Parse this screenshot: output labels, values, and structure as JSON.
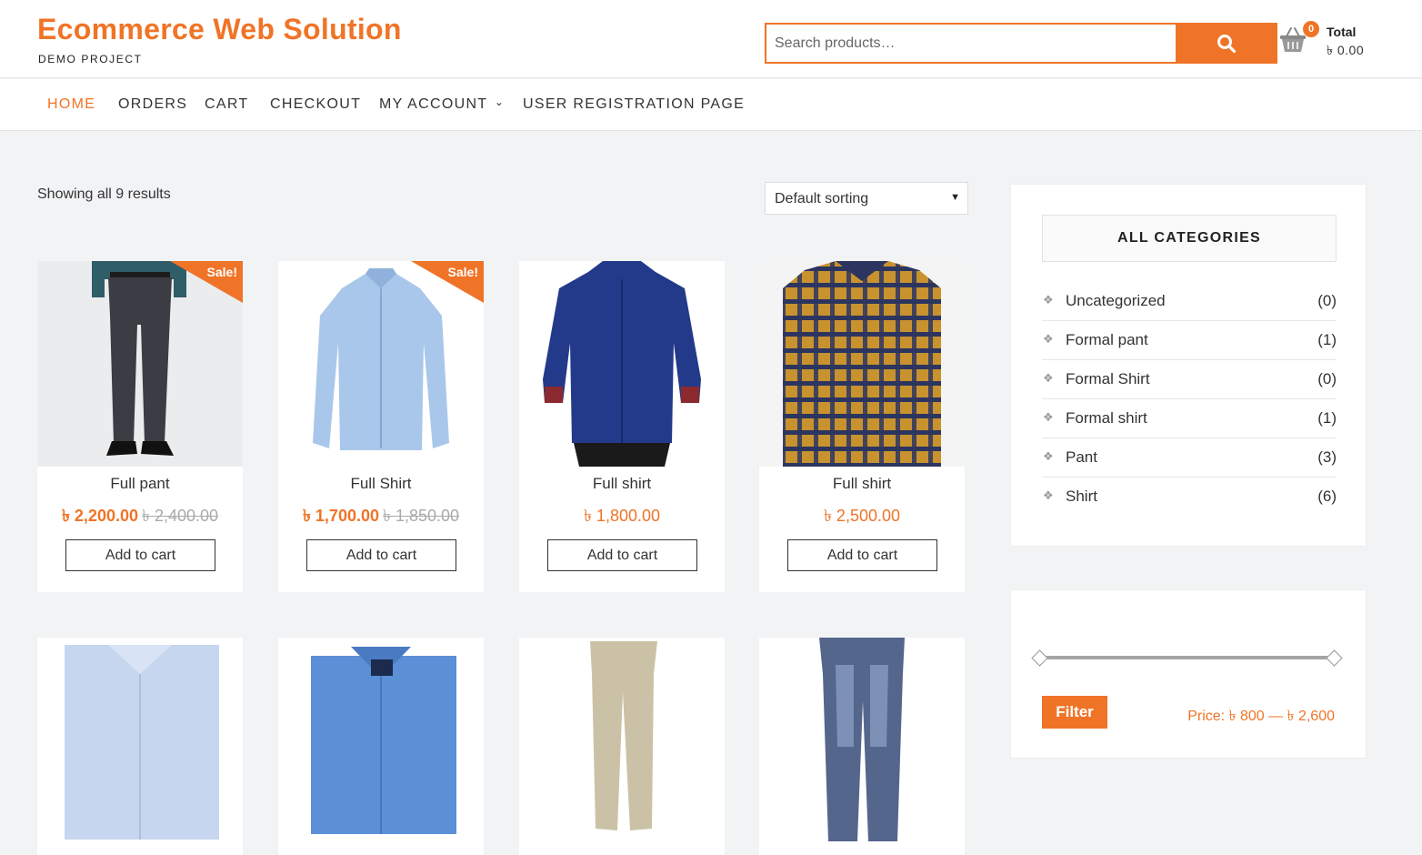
{
  "site": {
    "title": "Ecommerce Web Solution",
    "subtitle": "DEMO PROJECT"
  },
  "search": {
    "placeholder": "Search products…",
    "icon": "search-icon"
  },
  "cart": {
    "icon": "basket-icon",
    "count": "0",
    "total_label": "Total",
    "total_value": "৳ 0.00"
  },
  "nav": {
    "items": [
      {
        "label": "HOME",
        "active": true
      },
      {
        "label": "ORDERS"
      },
      {
        "label": "CART"
      },
      {
        "label": "CHECKOUT"
      },
      {
        "label": "MY ACCOUNT",
        "has_dropdown": true,
        "chevron": "⌄"
      },
      {
        "label": "USER REGISTRATION PAGE"
      }
    ]
  },
  "shop": {
    "result_count": "Showing all 9 results",
    "sorting": "Default sorting",
    "sort_arrow": "▼"
  },
  "products": [
    {
      "name": "Full pant",
      "price": "৳ 2,200.00",
      "old_price": "৳ 2,400.00",
      "sale": "Sale!",
      "button": "Add to cart",
      "image": "dark-formal-trousers"
    },
    {
      "name": "Full Shirt",
      "price": "৳ 1,700.00",
      "old_price": "৳ 1,850.00",
      "sale": "Sale!",
      "button": "Add to cart",
      "image": "light-blue-shirt"
    },
    {
      "name": "Full shirt",
      "price": "৳ 1,800.00",
      "button": "Add to cart",
      "image": "navy-shirt-model"
    },
    {
      "name": "Full shirt",
      "price": "৳ 2,500.00",
      "button": "Add to cart",
      "image": "plaid-shirt"
    },
    {
      "name": "",
      "image": "pale-blue-shirt"
    },
    {
      "name": "",
      "image": "blue-formal-shirt"
    },
    {
      "name": "",
      "image": "khaki-chinos"
    },
    {
      "name": "",
      "image": "denim-jeans"
    }
  ],
  "categories": {
    "title": "ALL CATEGORIES",
    "bullet": "❖",
    "items": [
      {
        "name": "Uncategorized",
        "count": "(0)"
      },
      {
        "name": "Formal pant",
        "count": "(1)"
      },
      {
        "name": "Formal Shirt",
        "count": "(0)"
      },
      {
        "name": "Formal shirt",
        "count": "(1)"
      },
      {
        "name": "Pant",
        "count": "(3)"
      },
      {
        "name": "Shirt",
        "count": "(6)"
      }
    ]
  },
  "price_filter": {
    "button": "Filter",
    "range": "Price: ৳ 800 — ৳ 2,600"
  },
  "colors": {
    "accent": "#f07427",
    "background": "#f2f3f5"
  }
}
